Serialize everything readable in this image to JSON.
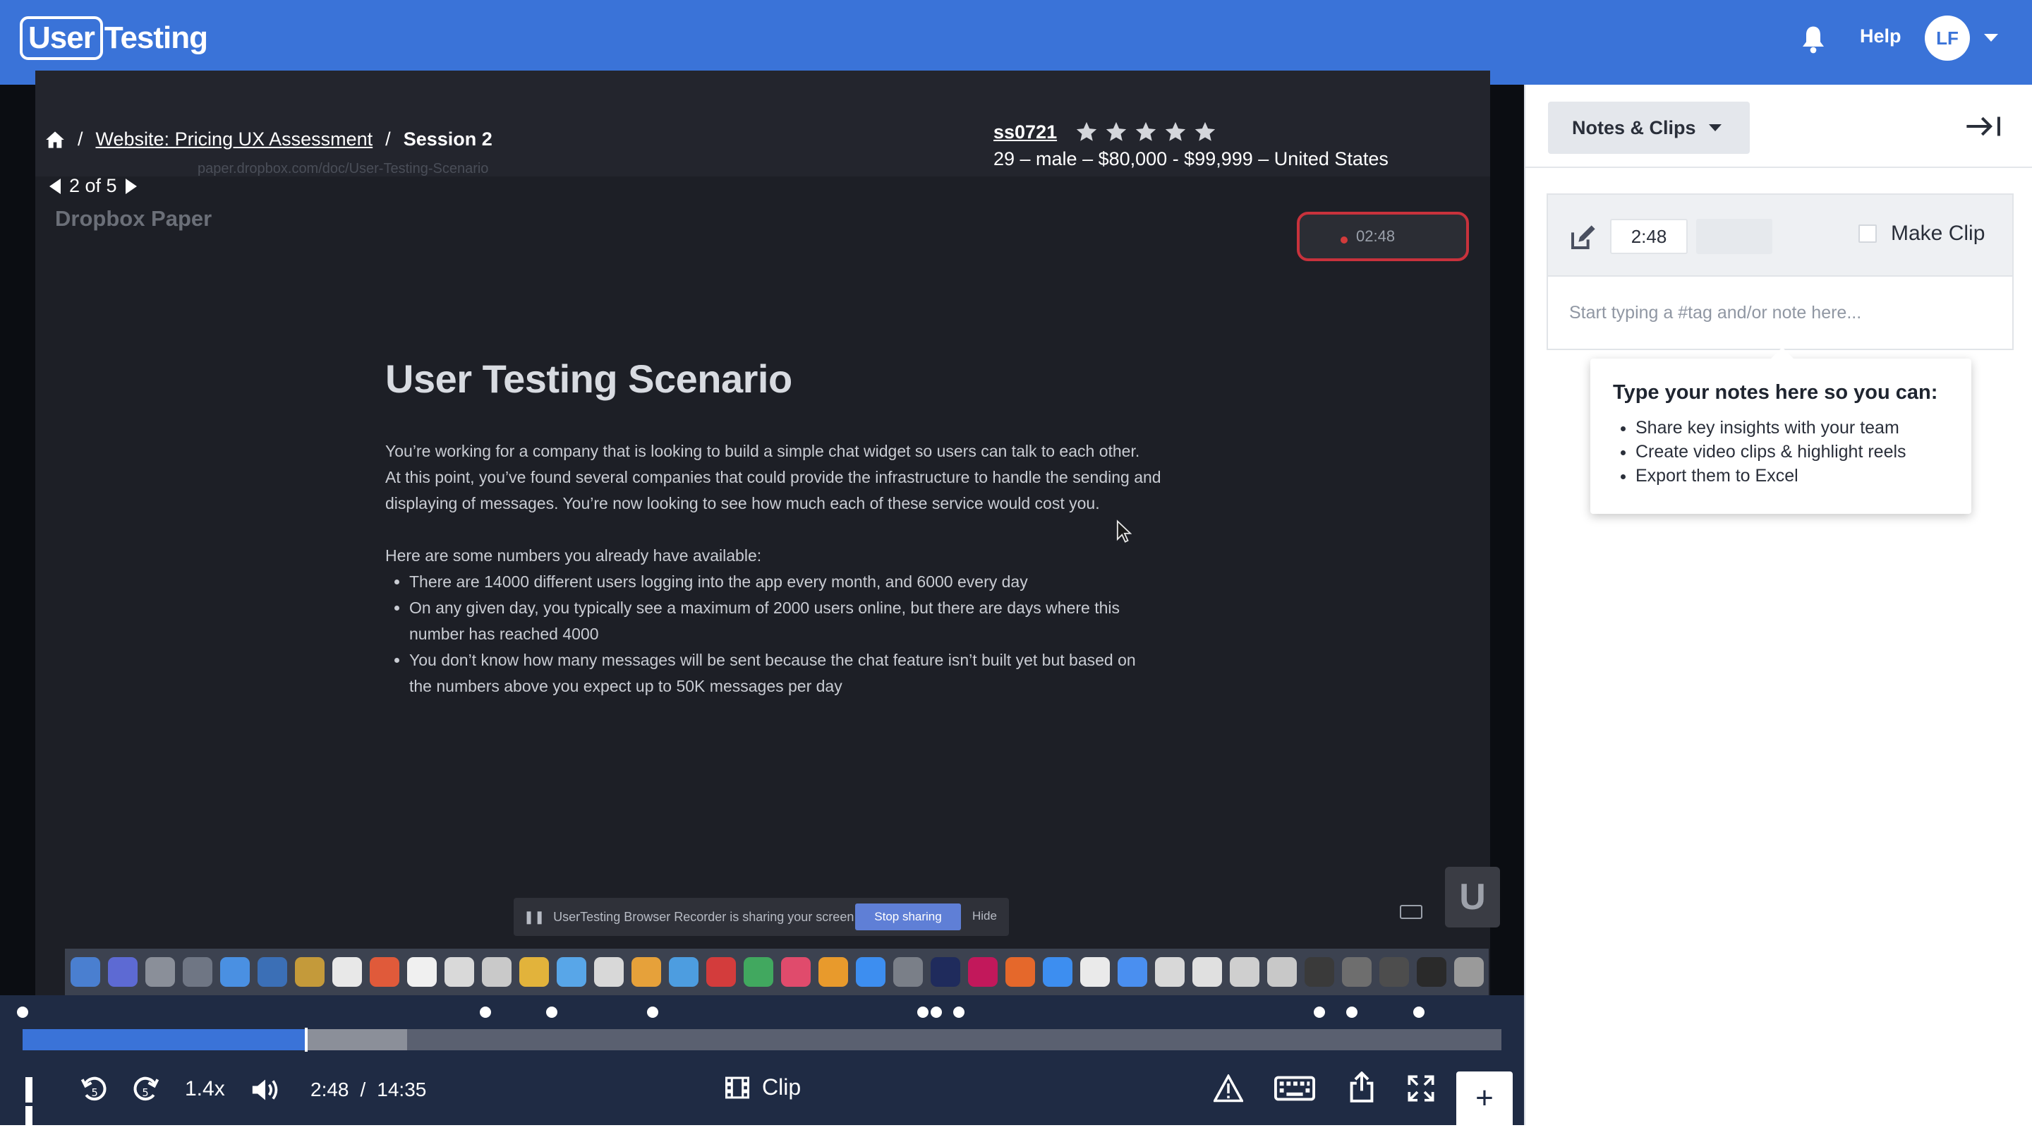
{
  "header": {
    "logo_user": "User",
    "logo_testing": "Testing",
    "help_label": "Help",
    "avatar_initials": "LF"
  },
  "video": {
    "breadcrumb": {
      "project": "Website: Pricing UX Assessment",
      "session": "Session 2"
    },
    "pager": "2 of 5",
    "tester": {
      "id": "ss0721",
      "rating_stars": 5,
      "demographics": "29 – male – $80,000 - $99,999 – United States"
    },
    "screen": {
      "url": "paper.dropbox.com/doc/User-Testing-Scenario",
      "app_name": "Dropbox Paper",
      "recording_time": "02:48",
      "doc_title": "User Testing Scenario",
      "paragraph1": "You’re working for a company that is looking to build a simple chat widget so users can talk to each other.",
      "paragraph2": "At this point, you’ve found several companies that could provide the infrastructure to handle the sending and displaying of messages. You’re now looking to see how much each of these service would cost you.",
      "paragraph3": "Here are some numbers you already have available:",
      "bullets": [
        "There are 14000 different users logging into the app every month, and 6000 every day",
        "On any given day, you typically see a maximum of 2000 users online, but there are days where this number has reached 4000",
        "You don’t know how many messages will be sent because the chat feature isn’t built yet but based on the numbers above you expect up to 50K messages per day"
      ],
      "share_banner_text": "UserTesting Browser Recorder is sharing your screen.",
      "stop_sharing_label": "Stop sharing",
      "hide_label": "Hide",
      "badge": "U"
    },
    "dock_colors": [
      "#4a7fd0",
      "#5d6ad3",
      "#8a8f99",
      "#6f7684",
      "#4a90e2",
      "#3b6fb6",
      "#c49a3a",
      "#e8e8e8",
      "#e05a3a",
      "#f0f0f0",
      "#d9d9d9",
      "#c9c9c9",
      "#e2b33b",
      "#58a6e8",
      "#d8d8d8",
      "#e6a13a",
      "#4d9de0",
      "#d33c3c",
      "#41a85f",
      "#e04b6c",
      "#e89a2c",
      "#3d8ef0",
      "#7a7f88",
      "#1f2b5c",
      "#c2185b",
      "#e5682b",
      "#3d8ef0",
      "#eaeaea",
      "#4a8ff0",
      "#d8d8d8",
      "#e0e0e0",
      "#cfcfcf",
      "#c8c8c8",
      "#3a3a3a",
      "#6e6e6e",
      "#4d4d4d",
      "#2a2a2a",
      "#9a9a9a"
    ]
  },
  "player": {
    "speed": "1.4x",
    "current_time": "2:48",
    "time_separator": "/",
    "duration": "14:35",
    "clip_label": "Clip",
    "plus_label": "+",
    "progress_fraction": 0.192,
    "buffered_fraction": 0.26,
    "marker_times_fraction": [
      0.0,
      0.313,
      0.358,
      0.426,
      0.609,
      0.618,
      0.633,
      0.877,
      0.899,
      0.944
    ]
  },
  "panel": {
    "notes_dropdown_label": "Notes & Clips",
    "note_time": "2:48",
    "make_clip_label": "Make Clip",
    "note_placeholder": "Start typing a #tag and/or note here...",
    "tip_title": "Type your notes here so you can:",
    "tip_items": [
      "Share key insights with your team",
      "Create video clips & highlight reels",
      "Export them to Excel"
    ]
  },
  "colors": {
    "brand_blue": "#3a73d8",
    "controls_bg": "#1f2b44",
    "record_red": "#c8323c"
  }
}
